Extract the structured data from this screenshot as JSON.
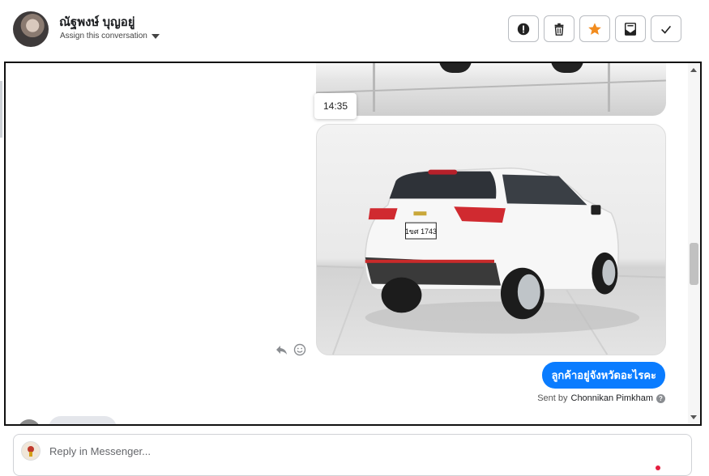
{
  "header": {
    "contact_name": "ณัฐพงษ์ บุญอยู่",
    "assign_label": "Assign this conversation",
    "actions": [
      {
        "name": "mark-spam-button",
        "icon": "alert-icon"
      },
      {
        "name": "delete-button",
        "icon": "trash-icon"
      },
      {
        "name": "star-button",
        "icon": "star-icon",
        "color": "#f28c1e"
      },
      {
        "name": "mark-unread-button",
        "icon": "envelope-icon"
      },
      {
        "name": "mark-done-button",
        "icon": "check-icon"
      }
    ]
  },
  "conversation": {
    "timestamp": "14:35",
    "car_plate": "1ขศ 1743",
    "message_text": "ลูกค้าอยู่จังหวัดอะไรคะ",
    "sent_by_prefix": "Sent by",
    "sent_by_name": "Chonnikan Pimkham",
    "bubble_color": "#0a7cff"
  },
  "reply": {
    "placeholder": "Reply in Messenger..."
  }
}
